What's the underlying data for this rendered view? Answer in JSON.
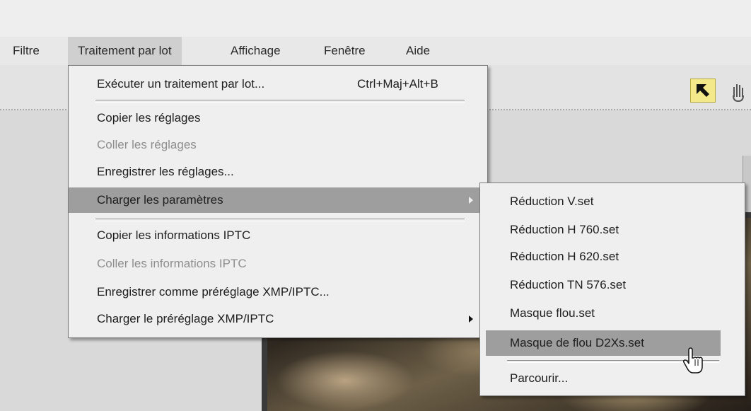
{
  "menubar": {
    "items": [
      {
        "label": "Filtre"
      },
      {
        "label": "Traitement par lot"
      },
      {
        "label": "Affichage"
      },
      {
        "label": "Fenêtre"
      },
      {
        "label": "Aide"
      }
    ]
  },
  "batch_menu": {
    "items": [
      {
        "label": "Exécuter un traitement par lot...",
        "shortcut": "Ctrl+Maj+Alt+B",
        "enabled": true
      },
      {
        "label": "Copier les réglages",
        "enabled": true
      },
      {
        "label": "Coller les réglages",
        "enabled": false
      },
      {
        "label": "Enregistrer les réglages...",
        "enabled": true
      },
      {
        "label": "Charger les paramètres",
        "enabled": true,
        "submenu": true,
        "highlighted": true
      },
      {
        "label": "Copier les informations IPTC",
        "enabled": true
      },
      {
        "label": "Coller les informations IPTC",
        "enabled": false
      },
      {
        "label": "Enregistrer comme préréglage XMP/IPTC...",
        "enabled": true
      },
      {
        "label": "Charger le préréglage XMP/IPTC",
        "enabled": true,
        "submenu": true
      }
    ]
  },
  "settings_submenu": {
    "items": [
      {
        "label": "Réduction V.set"
      },
      {
        "label": "Réduction H 760.set"
      },
      {
        "label": "Réduction H 620.set"
      },
      {
        "label": "Réduction TN 576.set"
      },
      {
        "label": "Masque flou.set"
      },
      {
        "label": "Masque de flou D2Xs.set",
        "highlighted": true
      },
      {
        "label": "Parcourir..."
      }
    ]
  },
  "toolbar": {
    "tools": [
      "arrow-select-icon",
      "hand-icon"
    ]
  },
  "colors": {
    "menu_bg": "#efefef",
    "highlight": "#9e9e9e",
    "disabled_text": "#8e8e8e",
    "tool_active": "#f3e98a"
  }
}
